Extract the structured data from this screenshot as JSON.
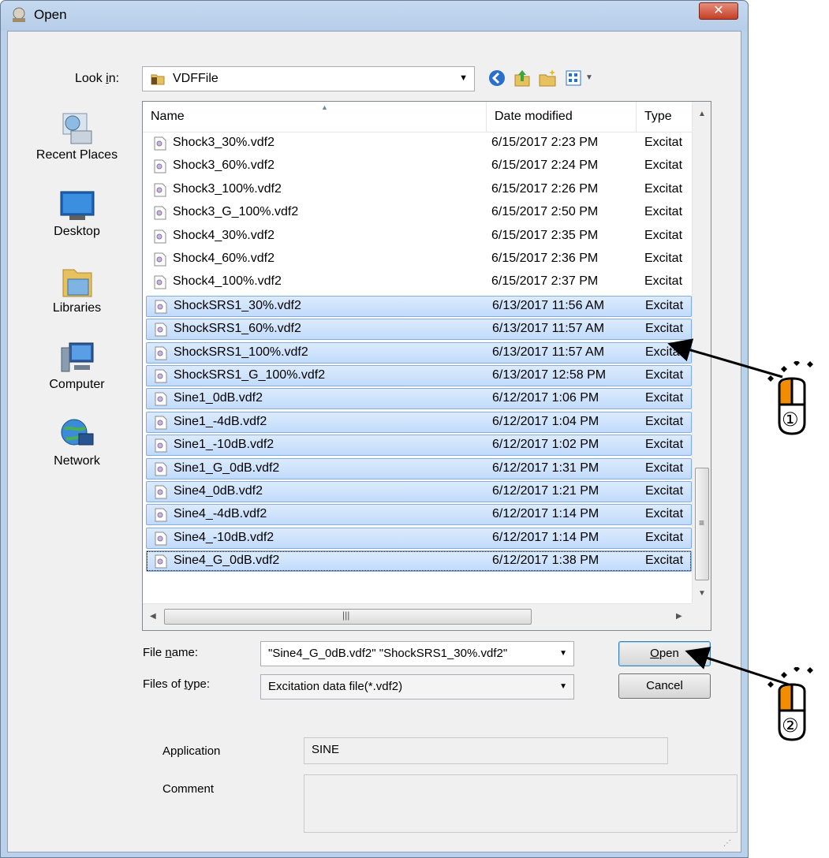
{
  "window": {
    "title": "Open",
    "close_label": "✕"
  },
  "lookin": {
    "label": "Look in:",
    "label_mnemonic": "i",
    "value": "VDFFile"
  },
  "places": [
    {
      "label": "Recent Places",
      "icon": "recent-places-icon"
    },
    {
      "label": "Desktop",
      "icon": "desktop-icon"
    },
    {
      "label": "Libraries",
      "icon": "libraries-icon"
    },
    {
      "label": "Computer",
      "icon": "computer-icon"
    },
    {
      "label": "Network",
      "icon": "network-icon"
    }
  ],
  "list": {
    "columns": [
      "Name",
      "Date modified",
      "Type"
    ],
    "rows": [
      {
        "name": "Shock3_30%.vdf2",
        "date": "6/15/2017 2:23 PM",
        "type": "Excitat",
        "selected": false
      },
      {
        "name": "Shock3_60%.vdf2",
        "date": "6/15/2017 2:24 PM",
        "type": "Excitat",
        "selected": false
      },
      {
        "name": "Shock3_100%.vdf2",
        "date": "6/15/2017 2:26 PM",
        "type": "Excitat",
        "selected": false
      },
      {
        "name": "Shock3_G_100%.vdf2",
        "date": "6/15/2017 2:50 PM",
        "type": "Excitat",
        "selected": false
      },
      {
        "name": "Shock4_30%.vdf2",
        "date": "6/15/2017 2:35 PM",
        "type": "Excitat",
        "selected": false
      },
      {
        "name": "Shock4_60%.vdf2",
        "date": "6/15/2017 2:36 PM",
        "type": "Excitat",
        "selected": false
      },
      {
        "name": "Shock4_100%.vdf2",
        "date": "6/15/2017 2:37 PM",
        "type": "Excitat",
        "selected": false
      },
      {
        "name": "ShockSRS1_30%.vdf2",
        "date": "6/13/2017 11:56 AM",
        "type": "Excitat",
        "selected": true
      },
      {
        "name": "ShockSRS1_60%.vdf2",
        "date": "6/13/2017 11:57 AM",
        "type": "Excitat",
        "selected": true
      },
      {
        "name": "ShockSRS1_100%.vdf2",
        "date": "6/13/2017 11:57 AM",
        "type": "Excitat",
        "selected": true
      },
      {
        "name": "ShockSRS1_G_100%.vdf2",
        "date": "6/13/2017 12:58 PM",
        "type": "Excitat",
        "selected": true
      },
      {
        "name": "Sine1_0dB.vdf2",
        "date": "6/12/2017 1:06 PM",
        "type": "Excitat",
        "selected": true
      },
      {
        "name": "Sine1_-4dB.vdf2",
        "date": "6/12/2017 1:04 PM",
        "type": "Excitat",
        "selected": true
      },
      {
        "name": "Sine1_-10dB.vdf2",
        "date": "6/12/2017 1:02 PM",
        "type": "Excitat",
        "selected": true
      },
      {
        "name": "Sine1_G_0dB.vdf2",
        "date": "6/12/2017 1:31 PM",
        "type": "Excitat",
        "selected": true
      },
      {
        "name": "Sine4_0dB.vdf2",
        "date": "6/12/2017 1:21 PM",
        "type": "Excitat",
        "selected": true
      },
      {
        "name": "Sine4_-4dB.vdf2",
        "date": "6/12/2017 1:14 PM",
        "type": "Excitat",
        "selected": true
      },
      {
        "name": "Sine4_-10dB.vdf2",
        "date": "6/12/2017 1:14 PM",
        "type": "Excitat",
        "selected": true
      },
      {
        "name": "Sine4_G_0dB.vdf2",
        "date": "6/12/2017 1:38 PM",
        "type": "Excitat",
        "selected": true
      }
    ]
  },
  "filename": {
    "label": "File name:",
    "label_mnemonic": "n",
    "value": "\"Sine4_G_0dB.vdf2\" \"ShockSRS1_30%.vdf2\""
  },
  "filetype": {
    "label": "Files of type:",
    "label_mnemonic": "t",
    "value": "Excitation data file(*.vdf2)"
  },
  "buttons": {
    "open": "Open",
    "open_mnemonic": "O",
    "cancel": "Cancel"
  },
  "info": {
    "application_label": "Application",
    "application_value": "SINE",
    "comment_label": "Comment",
    "comment_value": ""
  },
  "annotations": {
    "marker_1": "①",
    "marker_2": "②"
  },
  "colors": {
    "selection": "#c1dbfc",
    "mouse_button": "#f28c00",
    "title_bar": "#b9d1ea"
  }
}
